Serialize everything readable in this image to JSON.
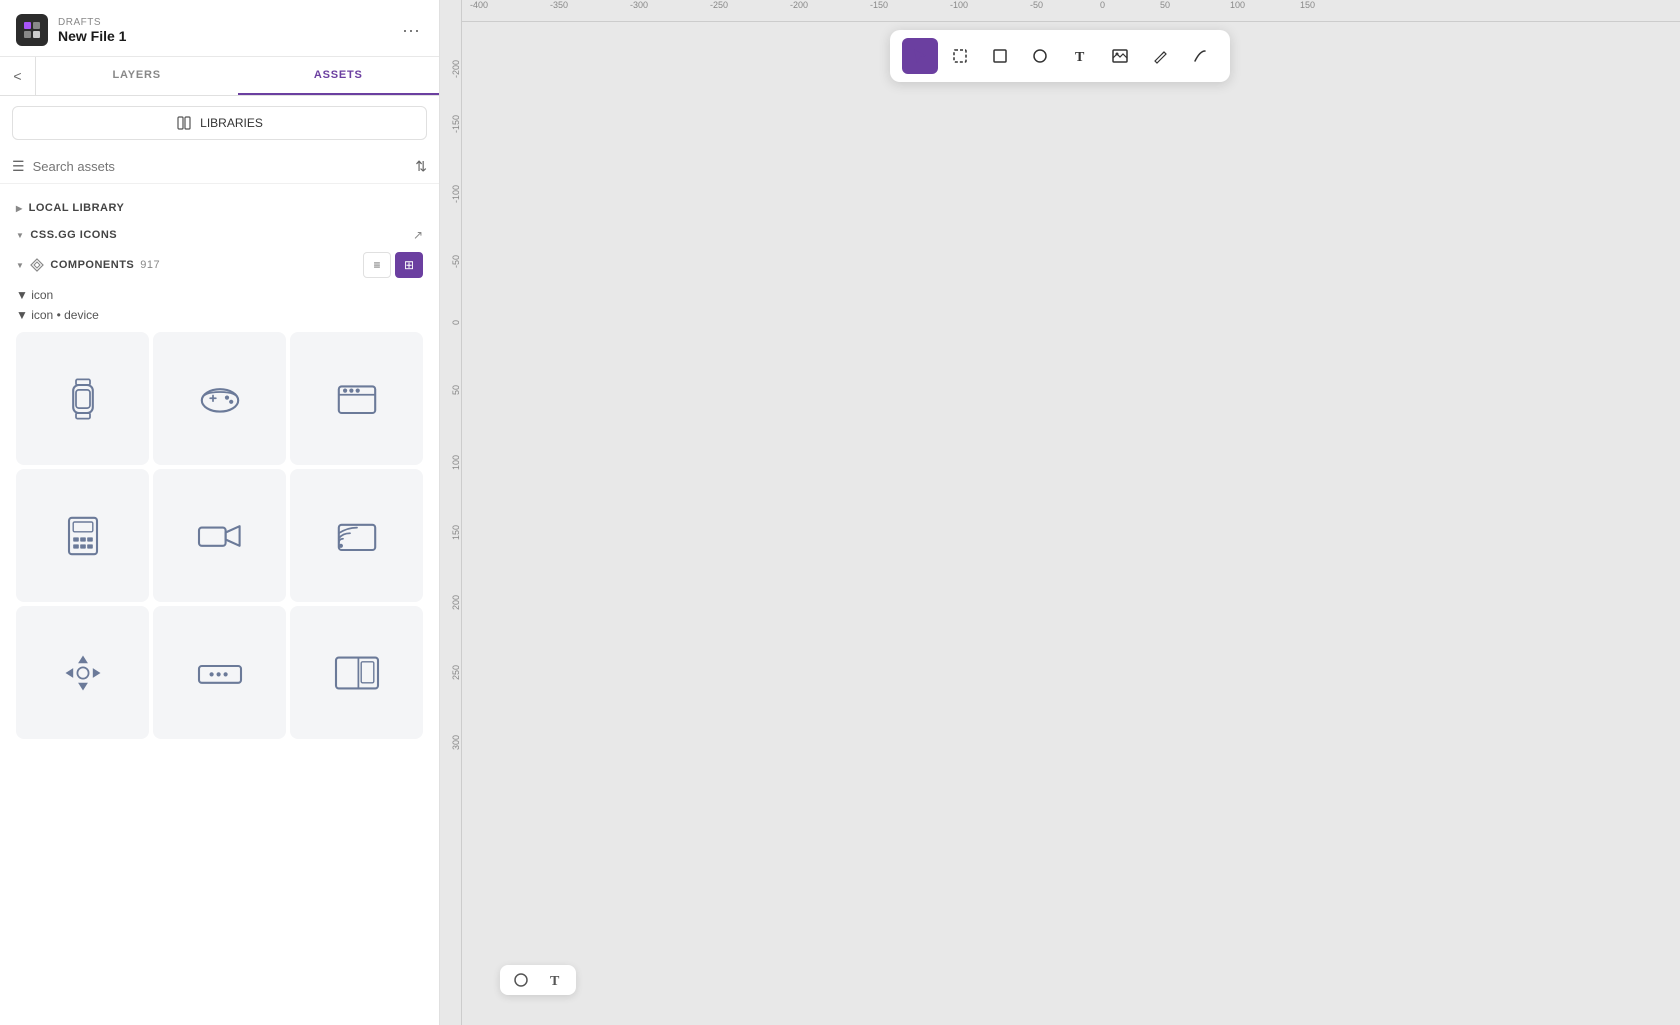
{
  "app": {
    "drafts_label": "DRAFTS",
    "filename": "New File 1",
    "more_icon": "⋯"
  },
  "tabs": {
    "back_label": "<",
    "layers_label": "LAYERS",
    "assets_label": "ASSETS"
  },
  "sidebar": {
    "libraries_label": "LIBRARIES",
    "search_placeholder": "Search assets",
    "local_library_label": "LOCAL LIBRARY",
    "cssgg_label": "CSS.GG ICONS",
    "components_label": "COMPONENTS",
    "components_count": "917",
    "icon_group_label": "icon",
    "icon_device_label": "icon • device"
  },
  "toolbar": {
    "tools": [
      {
        "name": "select",
        "label": "▲",
        "active": true
      },
      {
        "name": "region-select",
        "label": "⬚"
      },
      {
        "name": "rectangle",
        "label": "□"
      },
      {
        "name": "ellipse",
        "label": "○"
      },
      {
        "name": "text",
        "label": "T"
      },
      {
        "name": "image",
        "label": "⊠"
      },
      {
        "name": "pen",
        "label": "✏"
      },
      {
        "name": "connect",
        "label": "⌒"
      }
    ]
  },
  "mini_toolbar": {
    "circle_label": "○",
    "text_label": "T"
  },
  "ruler": {
    "top_values": [
      "-400",
      "-350",
      "-300",
      "-250",
      "-200",
      "-150",
      "-100",
      "-50",
      "0",
      "50",
      "100",
      "150"
    ],
    "left_values": [
      "-200",
      "-150",
      "-100",
      "-50",
      "0",
      "50",
      "100",
      "150",
      "200",
      "250",
      "300"
    ]
  },
  "view_toggle": {
    "list_label": "≡",
    "grid_label": "⊞"
  }
}
